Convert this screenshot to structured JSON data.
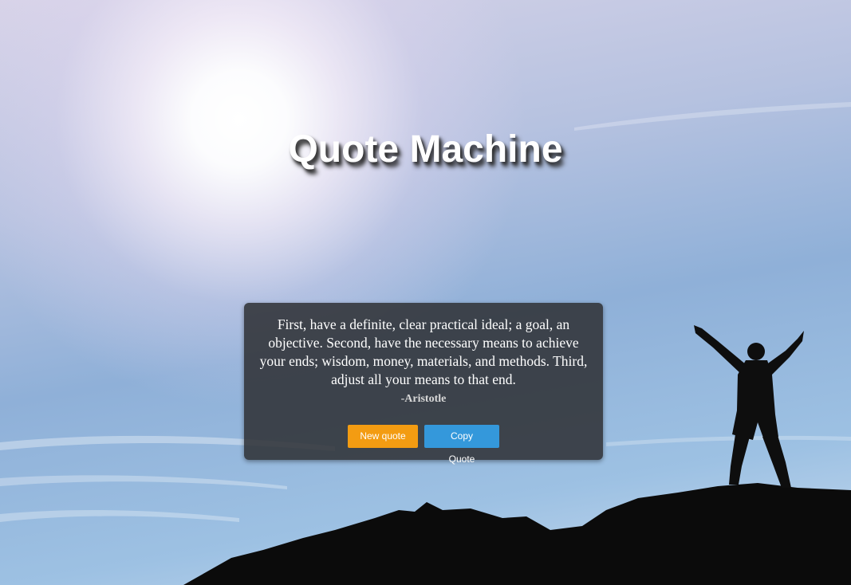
{
  "page": {
    "title": "Quote Machine"
  },
  "quote": {
    "text": "First, have a definite, clear practical ideal; a goal, an objective. Second, have the necessary means to achieve your ends; wisdom, money, materials, and methods. Third, adjust all your means to that end.",
    "author": "-Aristotle"
  },
  "buttons": {
    "new_quote_label": "New quote",
    "copy_quote_label": "Copy Quote"
  },
  "colors": {
    "new_quote_button": "#f39c12",
    "copy_quote_button": "#3498db",
    "quote_box": "#303237",
    "title_text": "#ffffff"
  }
}
